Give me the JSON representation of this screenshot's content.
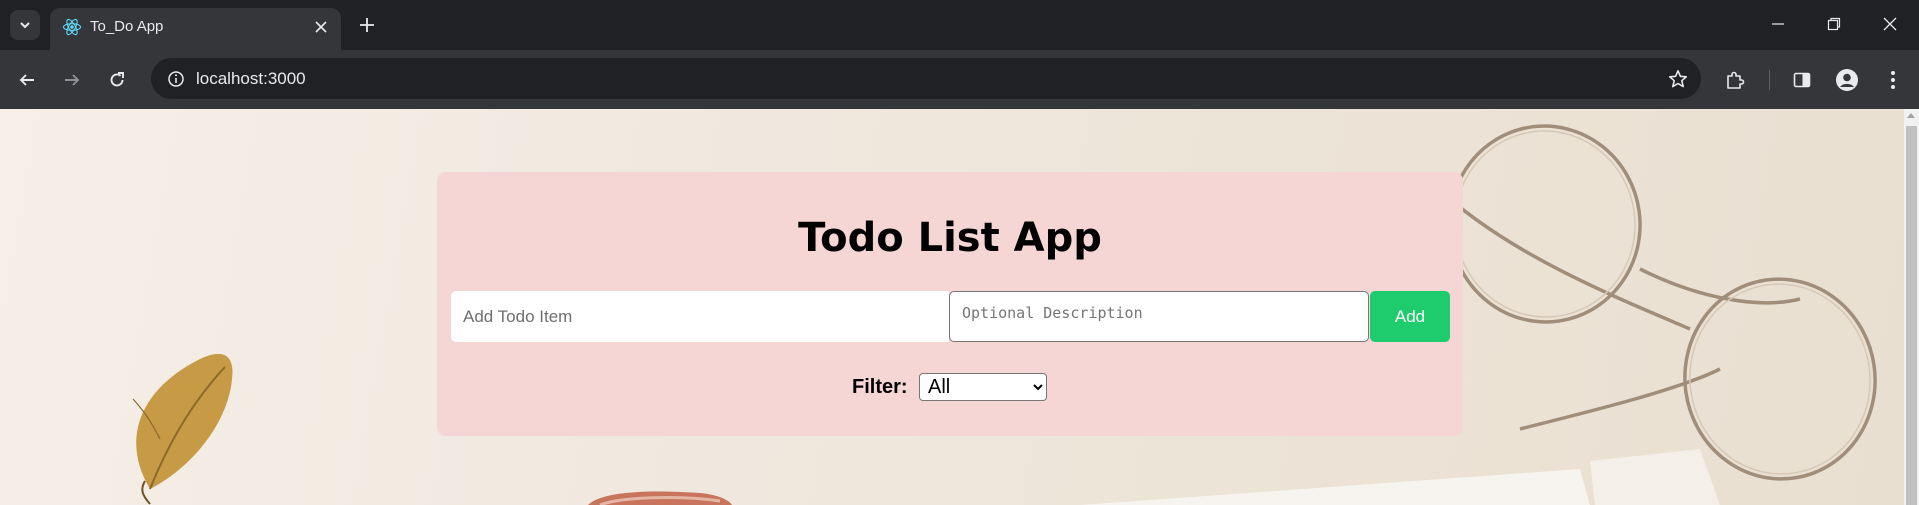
{
  "browser": {
    "tab": {
      "title": "To_Do App",
      "favicon": "react-icon"
    },
    "address": {
      "url": "localhost:3000"
    },
    "icons": {
      "tab_search": "chevron-down-icon",
      "tab_close": "close-icon",
      "new_tab": "plus-icon",
      "back": "arrow-left-icon",
      "forward": "arrow-right-icon",
      "reload": "reload-icon",
      "site_info": "info-icon",
      "bookmark": "star-icon",
      "extensions": "puzzle-icon",
      "side_panel": "side-panel-icon",
      "profile": "profile-icon",
      "menu": "kebab-menu-icon",
      "minimize": "minimize-icon",
      "restore": "restore-icon",
      "close_window": "close-icon"
    }
  },
  "app": {
    "title": "Todo List App",
    "todo_input": {
      "placeholder": "Add Todo Item",
      "value": ""
    },
    "description_input": {
      "placeholder": "Optional Description",
      "value": ""
    },
    "add_button": "Add",
    "filter": {
      "label": "Filter:",
      "selected": "All"
    }
  },
  "colors": {
    "card_background": "#f6d5d5",
    "add_button": "#1fcc6d",
    "browser_chrome": "#35363a"
  }
}
